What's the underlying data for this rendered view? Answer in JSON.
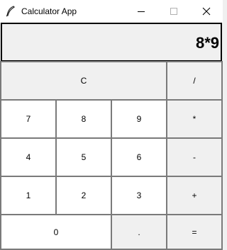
{
  "window": {
    "title": "Calculator App"
  },
  "display": {
    "value": "8*9"
  },
  "keys": {
    "clear": "C",
    "divide": "/",
    "seven": "7",
    "eight": "8",
    "nine": "9",
    "multiply": "*",
    "four": "4",
    "five": "5",
    "six": "6",
    "subtract": "-",
    "one": "1",
    "two": "2",
    "three": "3",
    "add": "+",
    "zero": "0",
    "decimal": ".",
    "equals": "="
  },
  "icons": {
    "app": "feather-icon",
    "minimize": "minimize-icon",
    "maximize": "maximize-icon",
    "close": "close-icon"
  }
}
